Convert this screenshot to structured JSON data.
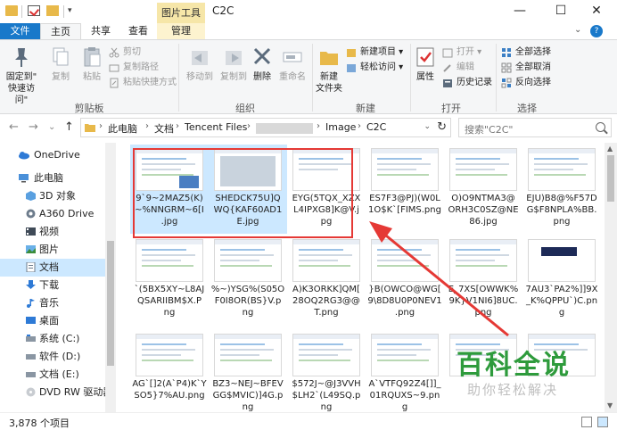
{
  "window": {
    "title": "C2C",
    "contextual_tab_title": "图片工具",
    "controls": {
      "minimize": "—",
      "maximize": "☐",
      "close": "✕"
    }
  },
  "quick_access": {
    "dropdown": "▾"
  },
  "tabs": [
    {
      "label": "文件"
    },
    {
      "label": "主页"
    },
    {
      "label": "共享"
    },
    {
      "label": "查看"
    },
    {
      "label": "管理"
    }
  ],
  "tabs_extra": {
    "chevron": "⌄",
    "help": "?"
  },
  "ribbon": {
    "clipboard": {
      "label": "剪贴板",
      "pin": "固定到\"\n快速访问\"",
      "copy": "复制",
      "paste": "粘贴",
      "cut": "剪切",
      "copy_path": "复制路径",
      "paste_shortcut": "粘贴快捷方式"
    },
    "organize": {
      "label": "组织",
      "move_to": "移动到",
      "copy_to": "复制到",
      "delete": "删除",
      "rename": "重命名"
    },
    "new": {
      "label": "新建",
      "new_folder": "新建\n文件夹",
      "new_item": "新建项目 ▾",
      "easy_access": "轻松访问 ▾"
    },
    "open": {
      "label": "打开",
      "properties": "属性",
      "open": "打开 ▾",
      "edit": "编辑",
      "history": "历史记录"
    },
    "select": {
      "label": "选择",
      "select_all": "全部选择",
      "select_none": "全部取消",
      "invert": "反向选择"
    }
  },
  "nav": {
    "back": "←",
    "forward": "→",
    "recent": "⌄",
    "up": "↑",
    "breadcrumb": [
      "此电脑",
      "文档",
      "Tencent Files",
      "",
      "Image",
      "C2C"
    ],
    "sep": "›",
    "dropdown": "⌄",
    "refresh": "↻",
    "search_placeholder": "搜索\"C2C\""
  },
  "sidebar": {
    "items": [
      {
        "label": "OneDrive",
        "icon": "cloud-icon"
      },
      {
        "label": "此电脑",
        "icon": "computer-icon"
      },
      {
        "label": "3D 对象",
        "icon": "cube-icon"
      },
      {
        "label": "A360 Drive",
        "icon": "drive-icon"
      },
      {
        "label": "视频",
        "icon": "video-icon"
      },
      {
        "label": "图片",
        "icon": "picture-icon"
      },
      {
        "label": "文档",
        "icon": "document-icon"
      },
      {
        "label": "下载",
        "icon": "download-icon"
      },
      {
        "label": "音乐",
        "icon": "music-icon"
      },
      {
        "label": "桌面",
        "icon": "desktop-icon"
      },
      {
        "label": "系统 (C:)",
        "icon": "disk-icon"
      },
      {
        "label": "软件 (D:)",
        "icon": "disk-icon"
      },
      {
        "label": "文档 (E:)",
        "icon": "disk-icon"
      },
      {
        "label": "DVD RW 驱动器",
        "icon": "dvd-icon"
      }
    ]
  },
  "files": [
    {
      "name": "9`9~2MAZ5(K)\n~%NNGRM~6[I\n.jpg",
      "selected": true
    },
    {
      "name": "SHEDCK75U]Q\nWQ{KAF60AD1\nE.jpg",
      "selected": true
    },
    {
      "name": "EYG(5TQX_XZX\nL4IPXG8]K@V.j\npg",
      "selected": false
    },
    {
      "name": "ES7F3@PJ)(W0L\n1O$K`[FIMS.png",
      "selected": false
    },
    {
      "name": "O)O9NTMA3@\nORH3C0SZ@NE\n86.jpg",
      "selected": false
    },
    {
      "name": "EJU)B8@%F57D\nG$F8NPLA%BB.\npng",
      "selected": false
    },
    {
      "name": "`(5BX5XY~L8AJ\nQSARIIBM$X.P\nng",
      "selected": false
    },
    {
      "name": "%~)YSG%(S05O\nF0I8OR(BS}V.p\nng",
      "selected": false
    },
    {
      "name": "A)K3ORKK]QM[\n28OQ2RG3@@\nT.png",
      "selected": false
    },
    {
      "name": "}B(OWCO@WG[\n9\\8D8U0P0NEV1\n.png",
      "selected": false
    },
    {
      "name": "E_7XS[OWWK%\n9K}V1NI6]8UC.\npng",
      "selected": false
    },
    {
      "name": "7AU3`PA2%]]9X\n_K%QPPU`)C.pn\ng",
      "selected": false
    },
    {
      "name": "AG`[]2(A`P4)K`Y\nSO5}7%AU.png",
      "selected": false
    },
    {
      "name": "BZ3~NEJ~BFEV\nGG$MVIC)]4G.p\nng",
      "selected": false
    },
    {
      "name": "$572J~@J3VVH\n$LH2`(L49SQ.p\nng",
      "selected": false
    },
    {
      "name": "A`VTFQ92Z4[]]_\n01RQUXS~9.pn\ng",
      "selected": false
    },
    {
      "name": "",
      "selected": false
    },
    {
      "name": "",
      "selected": false
    }
  ],
  "watermark": {
    "title": "百科全说",
    "subtitle": "助你轻松解决"
  },
  "status": {
    "count": "3,878 个项目"
  },
  "colors": {
    "accent": "#1979ca",
    "highlight_border": "#e53935",
    "watermark_green": "#2e9b3c"
  }
}
